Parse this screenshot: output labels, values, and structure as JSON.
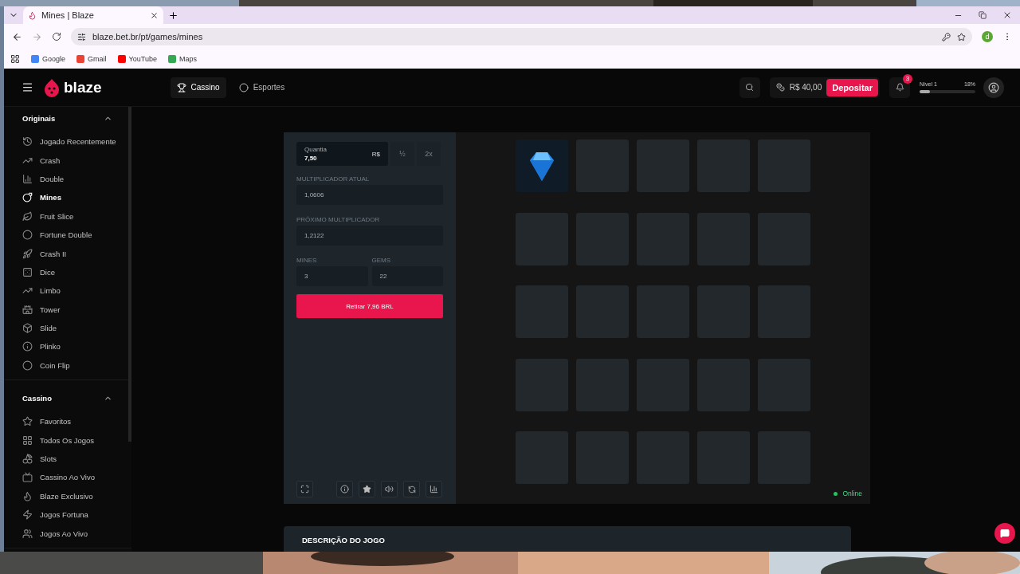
{
  "browser": {
    "tabs": [
      {
        "title": "Mines | Blaze",
        "selected": true
      }
    ],
    "url": "blaze.bet.br/pt/games/mines",
    "bookmarks": [
      {
        "label": "Google",
        "color": "#4285f4"
      },
      {
        "label": "Gmail",
        "color": "#ea4335"
      },
      {
        "label": "YouTube",
        "color": "#ff0000"
      },
      {
        "label": "Maps",
        "color": "#34a853"
      }
    ],
    "profile_initial": "d"
  },
  "header": {
    "logo": "blaze",
    "nav": [
      {
        "label": "Cassino",
        "selected": true
      },
      {
        "label": "Esportes",
        "selected": false
      }
    ],
    "balance": "R$ 40,00",
    "deposit": "Depositar",
    "notifications": "3",
    "level_label": "Nível 1",
    "level_percent": "18%",
    "level": 0.18
  },
  "sidebar": {
    "sections": [
      {
        "title": "Originais",
        "expanded": true,
        "items": [
          {
            "label": "Jogado Recentemente",
            "selected": false
          },
          {
            "label": "Crash",
            "selected": false
          },
          {
            "label": "Double",
            "selected": false
          },
          {
            "label": "Mines",
            "selected": true
          },
          {
            "label": "Fruit Slice",
            "selected": false
          },
          {
            "label": "Fortune Double",
            "selected": false
          },
          {
            "label": "Crash II",
            "selected": false
          },
          {
            "label": "Dice",
            "selected": false
          },
          {
            "label": "Limbo",
            "selected": false
          },
          {
            "label": "Tower",
            "selected": false
          },
          {
            "label": "Slide",
            "selected": false
          },
          {
            "label": "Plinko",
            "selected": false
          },
          {
            "label": "Coin Flip",
            "selected": false
          }
        ]
      },
      {
        "title": "Cassino",
        "expanded": true,
        "items": [
          {
            "label": "Favoritos",
            "selected": false
          },
          {
            "label": "Todos Os Jogos",
            "selected": false
          },
          {
            "label": "Slots",
            "selected": false
          },
          {
            "label": "Cassino Ao Vivo",
            "selected": false
          },
          {
            "label": "Blaze Exclusivo",
            "selected": false
          },
          {
            "label": "Jogos Fortuna",
            "selected": false
          },
          {
            "label": "Jogos Ao Vivo",
            "selected": false
          }
        ]
      }
    ]
  },
  "game": {
    "stake": {
      "label": "Quantia",
      "value": "7,50",
      "currency": "R$"
    },
    "half": {
      "label": "½",
      "disabled": true
    },
    "double": {
      "label": "2x",
      "disabled": true
    },
    "current_multiplier": {
      "label": "MULTIPLICADOR ATUAL",
      "value": "1,0606"
    },
    "next_multiplier": {
      "label": "PRÓXIMO MULTIPLICADOR",
      "value": "1,2122"
    },
    "mines": {
      "label": "MINES",
      "value": "3"
    },
    "gems": {
      "label": "GEMS",
      "value": "22"
    },
    "cashout": "Retirar 7,96 BRL",
    "tiles": [
      {
        "kind": "gem"
      },
      {
        "kind": "hidden"
      },
      {
        "kind": "hidden"
      },
      {
        "kind": "hidden"
      },
      {
        "kind": "hidden"
      },
      {
        "kind": "hidden"
      },
      {
        "kind": "hidden"
      },
      {
        "kind": "hidden"
      },
      {
        "kind": "hidden"
      },
      {
        "kind": "hidden"
      },
      {
        "kind": "hidden"
      },
      {
        "kind": "hidden"
      },
      {
        "kind": "hidden"
      },
      {
        "kind": "hidden"
      },
      {
        "kind": "hidden"
      },
      {
        "kind": "hidden"
      },
      {
        "kind": "hidden"
      },
      {
        "kind": "hidden"
      },
      {
        "kind": "hidden"
      },
      {
        "kind": "hidden"
      },
      {
        "kind": "hidden"
      },
      {
        "kind": "hidden"
      },
      {
        "kind": "hidden"
      },
      {
        "kind": "hidden"
      },
      {
        "kind": "hidden"
      }
    ],
    "status": {
      "label": "Online",
      "color": "#22c55e"
    }
  },
  "description": {
    "title": "DESCRIÇÃO DO JOGO"
  }
}
